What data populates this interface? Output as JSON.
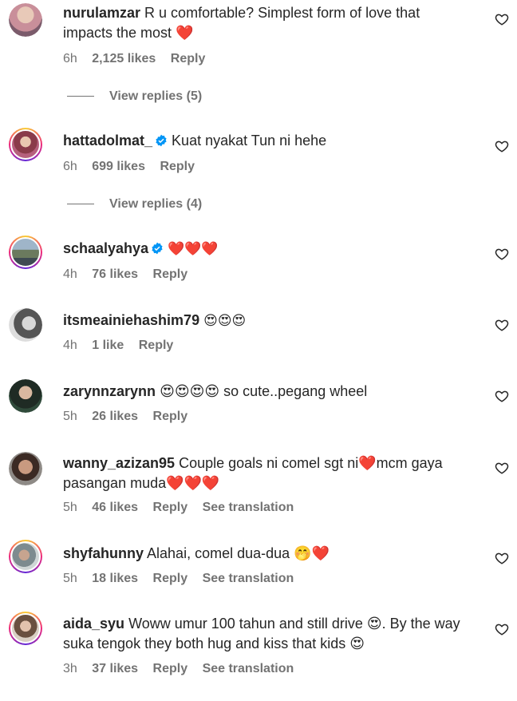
{
  "comments": [
    {
      "username": "nurulamzar",
      "verified": false,
      "text": "R u comfortable? Simplest form of love that impacts the most ❤️",
      "time": "6h",
      "likes": "2,125 likes",
      "reply": "Reply",
      "see_translation": "",
      "view_replies": "View replies (5)"
    },
    {
      "username": "hattadolmat_",
      "verified": true,
      "text": "Kuat nyakat Tun ni hehe",
      "time": "6h",
      "likes": "699 likes",
      "reply": "Reply",
      "see_translation": "",
      "view_replies": "View replies (4)"
    },
    {
      "username": "schaalyahya",
      "verified": true,
      "text": "❤️❤️❤️",
      "time": "4h",
      "likes": "76 likes",
      "reply": "Reply",
      "see_translation": ""
    },
    {
      "username": "itsmeainiehashim79",
      "verified": false,
      "text": "😍😍😍",
      "time": "4h",
      "likes": "1 like",
      "reply": "Reply",
      "see_translation": ""
    },
    {
      "username": "zarynnzarynn",
      "verified": false,
      "text": "😍😍😍😍 so cute..pegang wheel",
      "time": "5h",
      "likes": "26 likes",
      "reply": "Reply",
      "see_translation": ""
    },
    {
      "username": "wanny_azizan95",
      "verified": false,
      "text": "Couple goals ni comel sgt ni❤️mcm gaya pasangan muda❤️❤️❤️",
      "time": "5h",
      "likes": "46 likes",
      "reply": "Reply",
      "see_translation": "See translation"
    },
    {
      "username": "shyfahunny",
      "verified": false,
      "text": "Alahai, comel dua-dua 🤭❤️",
      "time": "5h",
      "likes": "18 likes",
      "reply": "Reply",
      "see_translation": "See translation"
    },
    {
      "username": "aida_syu",
      "verified": false,
      "text": "Woww umur 100 tahun and still drive 😍. By the way suka tengok they both hug and kiss that kids 😍",
      "time": "3h",
      "likes": "37 likes",
      "reply": "Reply",
      "see_translation": "See translation"
    }
  ],
  "icons": {
    "like": "heart-outline-icon",
    "verified": "verified-badge-icon"
  },
  "colors": {
    "text": "#262626",
    "secondary": "#737373",
    "verified": "#0095f6"
  }
}
